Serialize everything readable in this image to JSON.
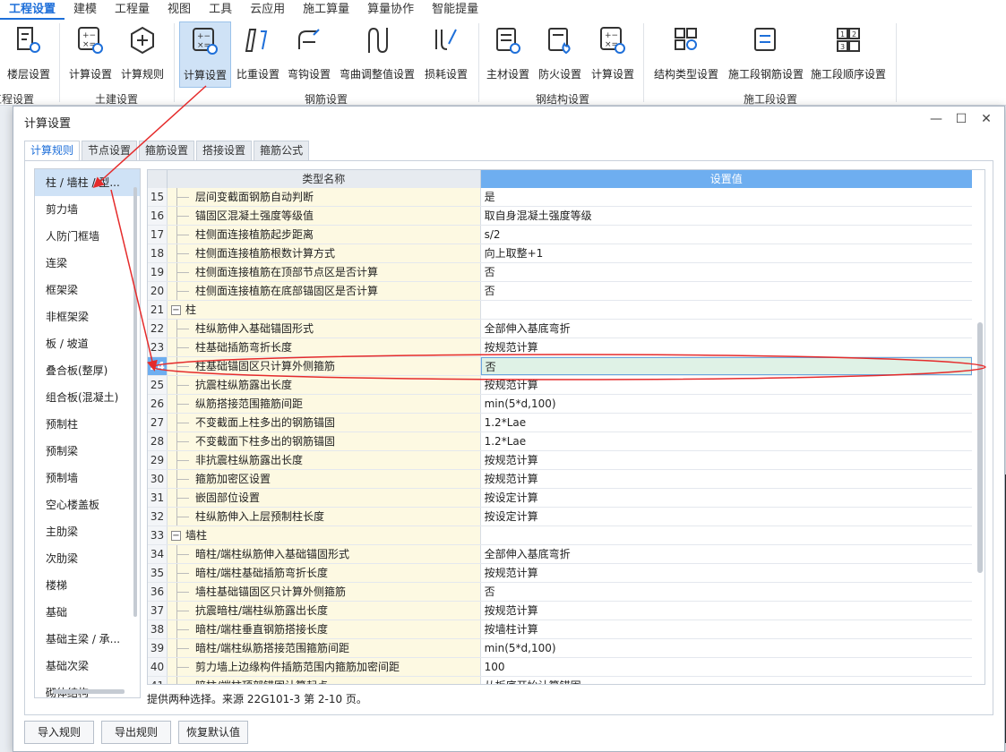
{
  "menu": [
    "工程设置",
    "建模",
    "工程量",
    "视图",
    "工具",
    "云应用",
    "施工算量",
    "算量协作",
    "智能提量"
  ],
  "ribbon": {
    "buttons": [
      "楼层设置",
      "计算设置",
      "计算规则",
      "计算设置",
      "比重设置",
      "弯钩设置",
      "弯曲调整值设置",
      "损耗设置",
      "主材设置",
      "防火设置",
      "计算设置",
      "结构类型设置",
      "施工段钢筋设置",
      "施工段顺序设置"
    ],
    "groups": [
      "工程设置",
      "土建设置",
      "钢筋设置",
      "钢结构设置",
      "施工段设置"
    ]
  },
  "dialog": {
    "title": "计算设置",
    "tabs": [
      "计算规则",
      "节点设置",
      "箍筋设置",
      "搭接设置",
      "箍筋公式"
    ],
    "left_items": [
      "柱 / 墙柱 / 型...",
      "剪力墙",
      "人防门框墙",
      "连梁",
      "框架梁",
      "非框架梁",
      "板 / 坡道",
      "叠合板(整厚)",
      "组合板(混凝土)",
      "预制柱",
      "预制梁",
      "预制墙",
      "空心楼盖板",
      "主肋梁",
      "次肋梁",
      "楼梯",
      "基础",
      "基础主梁 / 承...",
      "基础次梁",
      "砌体结构"
    ],
    "col_name": "类型名称",
    "col_value": "设置值",
    "rows": [
      {
        "n": "15",
        "name": "层间变截面钢筋自动判断",
        "val": "是"
      },
      {
        "n": "16",
        "name": "锚固区混凝土强度等级值",
        "val": "取自身混凝土强度等级"
      },
      {
        "n": "17",
        "name": "柱侧面连接植筋起步距离",
        "val": "s/2"
      },
      {
        "n": "18",
        "name": "柱侧面连接植筋根数计算方式",
        "val": "向上取整+1"
      },
      {
        "n": "19",
        "name": "柱侧面连接植筋在顶部节点区是否计算",
        "val": "否"
      },
      {
        "n": "20",
        "name": "柱侧面连接植筋在底部锚固区是否计算",
        "val": "否"
      },
      {
        "n": "21",
        "name": "柱",
        "val": "",
        "group": true
      },
      {
        "n": "22",
        "name": "柱纵筋伸入基础锚固形式",
        "val": "全部伸入基底弯折"
      },
      {
        "n": "23",
        "name": "柱基础插筋弯折长度",
        "val": "按规范计算"
      },
      {
        "n": "24",
        "name": "柱基础锚固区只计算外侧箍筋",
        "val": "否",
        "current": true
      },
      {
        "n": "25",
        "name": "抗震柱纵筋露出长度",
        "val": "按规范计算"
      },
      {
        "n": "26",
        "name": "纵筋搭接范围箍筋间距",
        "val": "min(5*d,100)"
      },
      {
        "n": "27",
        "name": "不变截面上柱多出的钢筋锚固",
        "val": "1.2*Lae"
      },
      {
        "n": "28",
        "name": "不变截面下柱多出的钢筋锚固",
        "val": "1.2*Lae"
      },
      {
        "n": "29",
        "name": "非抗震柱纵筋露出长度",
        "val": "按规范计算"
      },
      {
        "n": "30",
        "name": "箍筋加密区设置",
        "val": "按规范计算"
      },
      {
        "n": "31",
        "name": "嵌固部位设置",
        "val": "按设定计算"
      },
      {
        "n": "32",
        "name": "柱纵筋伸入上层预制柱长度",
        "val": "按设定计算"
      },
      {
        "n": "33",
        "name": "墙柱",
        "val": "",
        "group": true
      },
      {
        "n": "34",
        "name": "暗柱/端柱纵筋伸入基础锚固形式",
        "val": "全部伸入基底弯折"
      },
      {
        "n": "35",
        "name": "暗柱/端柱基础插筋弯折长度",
        "val": "按规范计算"
      },
      {
        "n": "36",
        "name": "墙柱基础锚固区只计算外侧箍筋",
        "val": "否"
      },
      {
        "n": "37",
        "name": "抗震暗柱/端柱纵筋露出长度",
        "val": "按规范计算"
      },
      {
        "n": "38",
        "name": "暗柱/端柱垂直钢筋搭接长度",
        "val": "按墙柱计算"
      },
      {
        "n": "39",
        "name": "暗柱/端柱纵筋搭接范围箍筋间距",
        "val": "min(5*d,100)"
      },
      {
        "n": "40",
        "name": "剪力墙上边缘构件插筋范围内箍筋加密间距",
        "val": "100"
      },
      {
        "n": "41",
        "name": "暗柱/端柱顶部锚固计算起点",
        "val": "从板底开始计算锚固"
      }
    ],
    "hint": "提供两种选择。来源 22G101-3 第 2-10 页。",
    "buttons": [
      "导入规则",
      "导出规则",
      "恢复默认值"
    ]
  }
}
